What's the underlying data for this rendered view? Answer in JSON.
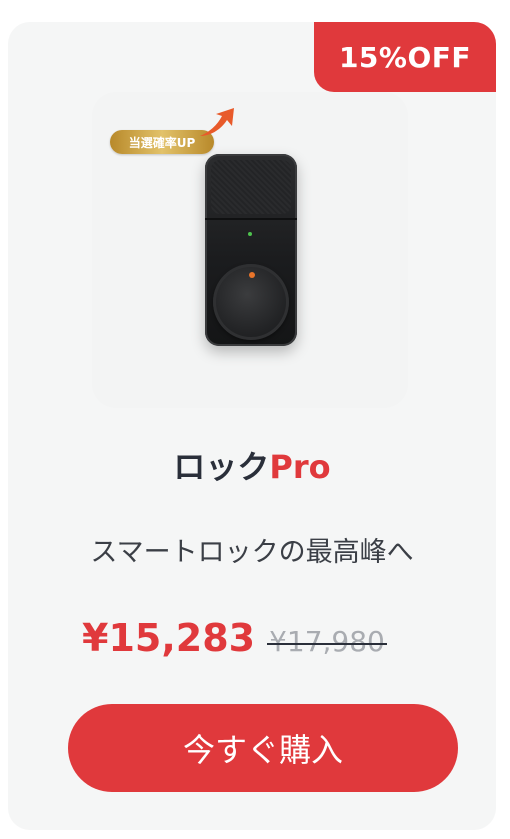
{
  "badge": {
    "discount_label": "15%OFF"
  },
  "product_image": {
    "promo_tag": "当選確率UP"
  },
  "product": {
    "title_main": "ロック",
    "title_accent": "Pro",
    "subtitle": "スマートロックの最高峰へ"
  },
  "pricing": {
    "sale_price": "¥15,283",
    "original_price": "¥17,980"
  },
  "cta": {
    "buy_label": "今すぐ購入"
  },
  "colors": {
    "accent": "#e0393c",
    "card_background": "#f5f6f6",
    "title_text": "#2a2f3a",
    "strikethrough_price": "#a9acb1",
    "promo_gold": "#d4a94a"
  },
  "icons": {
    "promo_arrow": "arrow-up-right-icon"
  }
}
